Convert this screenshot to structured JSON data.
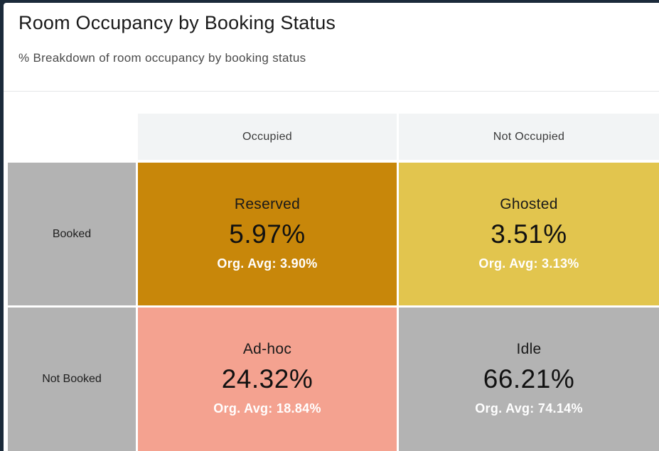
{
  "header": {
    "title": "Room Occupancy by Booking Status",
    "subtitle": "% Breakdown of room occupancy by booking status"
  },
  "chart_data": {
    "type": "table",
    "columns": [
      "Occupied",
      "Not Occupied"
    ],
    "rows": [
      "Booked",
      "Not Booked"
    ],
    "cells": [
      [
        {
          "label": "Reserved",
          "value": "5.97%",
          "org_avg": "Org. Avg: 3.90%",
          "color": "#c8870a"
        },
        {
          "label": "Ghosted",
          "value": "3.51%",
          "org_avg": "Org. Avg: 3.13%",
          "color": "#e2c54e"
        }
      ],
      [
        {
          "label": "Ad-hoc",
          "value": "24.32%",
          "org_avg": "Org. Avg: 18.84%",
          "color": "#f4a290"
        },
        {
          "label": "Idle",
          "value": "66.21%",
          "org_avg": "Org. Avg: 74.14%",
          "color": "#b3b3b3"
        }
      ]
    ],
    "row_header_color": "#b3b3b3",
    "column_header_color": "#f2f4f5"
  }
}
